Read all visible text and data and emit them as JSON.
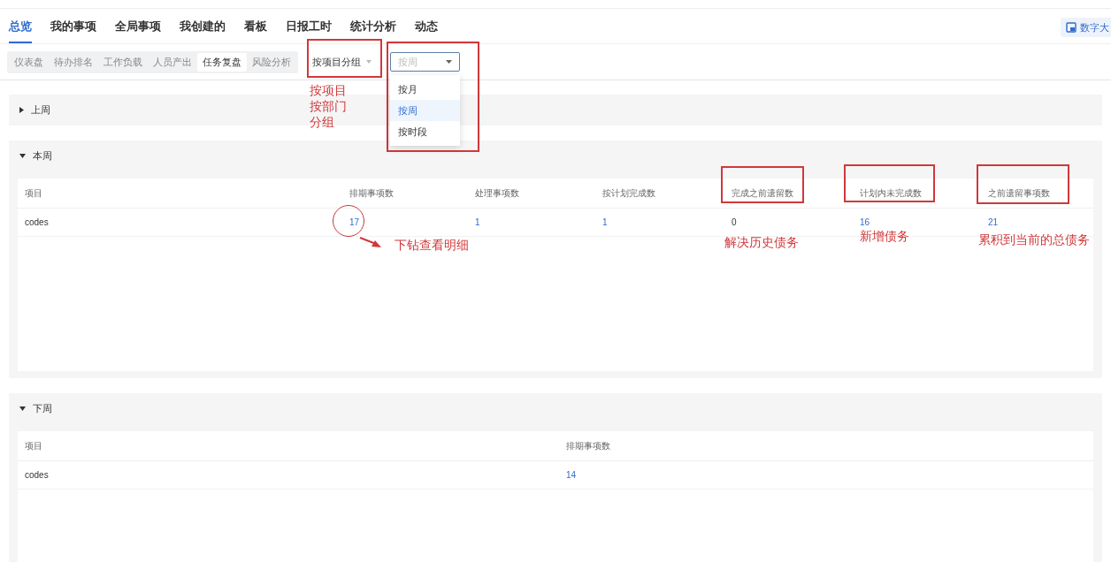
{
  "main_tabs": [
    {
      "label": "总览",
      "selected": true
    },
    {
      "label": "我的事项",
      "selected": false
    },
    {
      "label": "全局事项",
      "selected": false
    },
    {
      "label": "我创建的",
      "selected": false
    },
    {
      "label": "看板",
      "selected": false
    },
    {
      "label": "日报工时",
      "selected": false
    },
    {
      "label": "统计分析",
      "selected": false
    },
    {
      "label": "动态",
      "selected": false
    }
  ],
  "screen_button": {
    "label": "数字大"
  },
  "sub_tabs": [
    {
      "label": "仪表盘",
      "selected": false
    },
    {
      "label": "待办排名",
      "selected": false
    },
    {
      "label": "工作负载",
      "selected": false
    },
    {
      "label": "人员产出",
      "selected": false
    },
    {
      "label": "任务复盘",
      "selected": true
    },
    {
      "label": "风险分析",
      "selected": false
    }
  ],
  "group_select": {
    "value": "按项目分组"
  },
  "period_select": {
    "value": "按周",
    "expanded": true,
    "options": [
      {
        "label": "按月",
        "selected": false
      },
      {
        "label": "按周",
        "selected": true
      },
      {
        "label": "按时段",
        "selected": false
      }
    ]
  },
  "sections": [
    {
      "title": "上周",
      "expanded": false
    },
    {
      "title": "本周",
      "expanded": true,
      "columns": [
        "项目",
        "排期事项数",
        "处理事项数",
        "按计划完成数",
        "完成之前遗留数",
        "计划内未完成数",
        "之前遗留事项数"
      ],
      "rows": [
        [
          {
            "text": "codes",
            "link": false
          },
          {
            "text": "17",
            "link": true
          },
          {
            "text": "1",
            "link": true
          },
          {
            "text": "1",
            "link": true
          },
          {
            "text": "0",
            "link": false
          },
          {
            "text": "16",
            "link": true
          },
          {
            "text": "21",
            "link": true
          }
        ]
      ]
    },
    {
      "title": "下周",
      "expanded": true,
      "columns": [
        "项目",
        "排期事项数"
      ],
      "rows": [
        [
          {
            "text": "codes",
            "link": false
          },
          {
            "text": "14",
            "link": true
          }
        ]
      ]
    }
  ],
  "annotations": {
    "group_note": [
      "按项目",
      "按部门",
      "分组"
    ],
    "drill_note": "下钻查看明细",
    "notes": [
      "解决历史债务",
      "新增债务",
      "累积到当前的总债务"
    ]
  }
}
